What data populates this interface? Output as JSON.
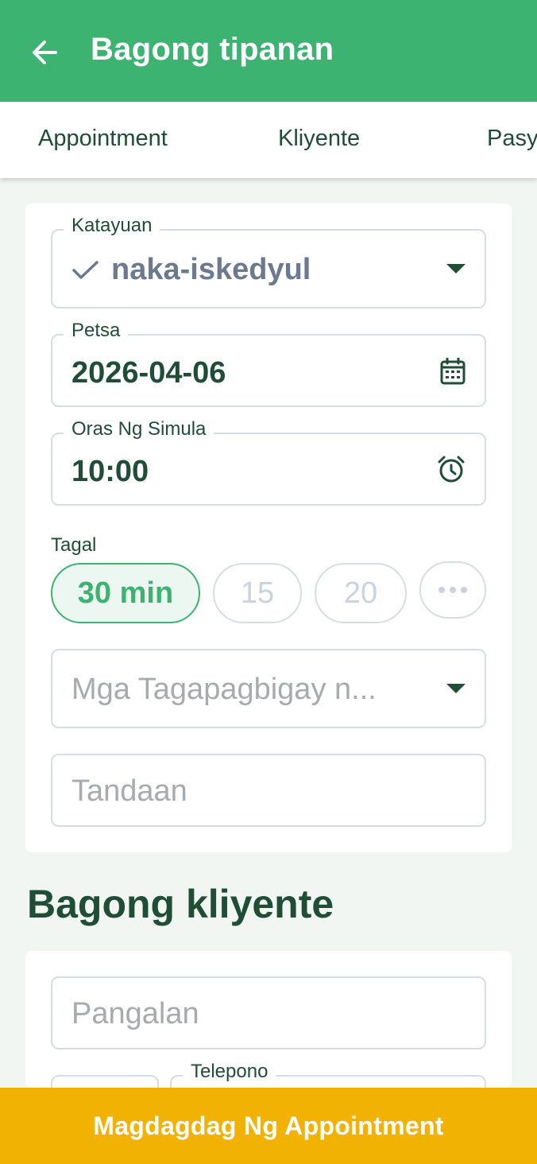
{
  "appbar": {
    "title": "Bagong tipanan",
    "back_icon": "arrow-left-icon"
  },
  "tabs": [
    {
      "label": "Appointment"
    },
    {
      "label": "Kliyente"
    },
    {
      "label": "Pasy"
    }
  ],
  "appointment": {
    "status": {
      "label": "Katayuan",
      "value": "naka-iskedyul",
      "icon": "check-icon"
    },
    "date": {
      "label": "Petsa",
      "value": "2026-04-06",
      "icon": "calendar-icon"
    },
    "start_time": {
      "label": "Oras Ng Simula",
      "value": "10:00",
      "icon": "alarm-icon"
    },
    "duration": {
      "label": "Tagal",
      "options": [
        "30 min",
        "15",
        "20"
      ],
      "selected": "30 min",
      "more_icon": "more-horizontal-icon"
    },
    "providers": {
      "placeholder": "Mga Tagapagbigay n..."
    },
    "notes": {
      "placeholder": "Tandaan"
    }
  },
  "new_client": {
    "title": "Bagong kliyente",
    "name": {
      "placeholder": "Pangalan"
    },
    "phone": {
      "label": "Telepono"
    }
  },
  "submit": {
    "label": "Magdagdag Ng Appointment"
  },
  "colors": {
    "primary": "#3cb371",
    "accent": "#f2b203",
    "text": "#1f4d36",
    "background": "#f1f6f3"
  }
}
